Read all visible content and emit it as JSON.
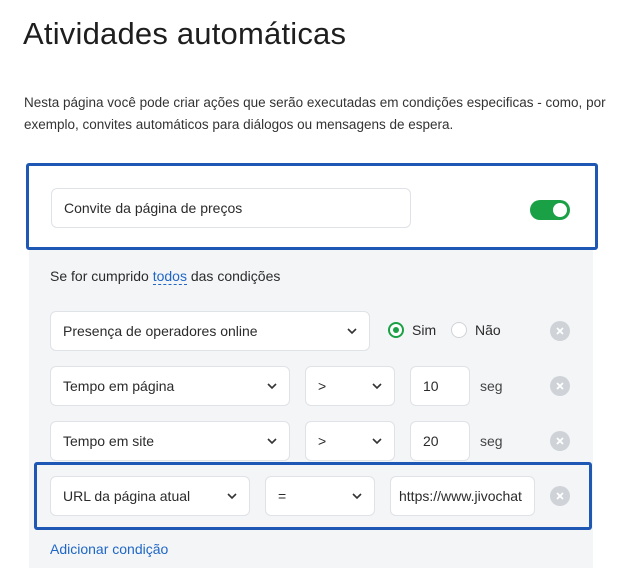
{
  "page": {
    "title": "Atividades automáticas",
    "description": "Nesta página você pode criar ações que serão executadas em condições especificas - como, por exemplo, convites automáticos para diálogos ou mensagens de espera."
  },
  "rule": {
    "name": "Convite da página de preços",
    "enabled": true,
    "conditions_prefix": "Se for cumprido",
    "conditions_mode": "todos",
    "conditions_suffix": "das condições"
  },
  "conditions": [
    {
      "field": "Presença de operadores online",
      "options": {
        "yes": "Sim",
        "no": "Não",
        "selected": "Sim"
      }
    },
    {
      "field": "Tempo em página",
      "operator": ">",
      "value": "10",
      "unit": "seg"
    },
    {
      "field": "Tempo em site",
      "operator": ">",
      "value": "20",
      "unit": "seg"
    },
    {
      "field": "URL da página atual",
      "operator": "=",
      "value": "https://www.jivochat"
    }
  ],
  "add_condition_label": "Adicionar condição",
  "colors": {
    "accent_blue": "#1f57b5",
    "link": "#1f66c6",
    "toggle_on": "#1aa146",
    "panel_bg": "#f3f5f7"
  }
}
